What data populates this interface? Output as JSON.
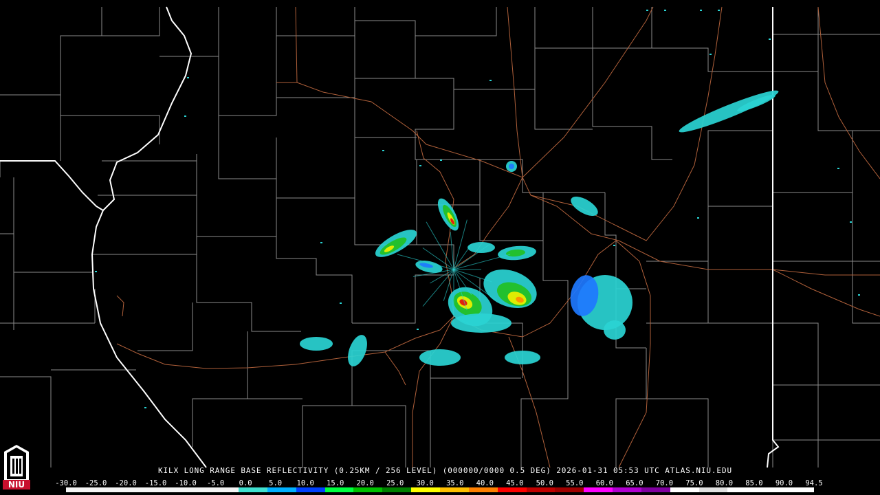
{
  "caption": "KILX LONG RANGE BASE REFLECTIVITY (0.25KM / 256 LEVEL) (000000/0000 0.5 DEG) 2026-01-31 05:53 UTC  ATLAS.NIU.EDU",
  "logo_text": "NIU",
  "scale": {
    "labels": [
      "-30.0",
      "-25.0",
      "-20.0",
      "-15.0",
      "-10.0",
      "-5.0",
      "0.0",
      "5.0",
      "10.0",
      "15.0",
      "20.0",
      "25.0",
      "30.0",
      "35.0",
      "40.0",
      "45.0",
      "50.0",
      "55.0",
      "60.0",
      "65.0",
      "70.0",
      "75.0",
      "80.0",
      "85.0",
      "90.0",
      "94.5"
    ],
    "colors": [
      "#000000",
      "#000000",
      "#000000",
      "#000000",
      "#000000",
      "#000000",
      "#40e0d0",
      "#00b0ff",
      "#0040ff",
      "#00ff40",
      "#00c000",
      "#008000",
      "#ffff00",
      "#ffc000",
      "#ff8000",
      "#ff0000",
      "#c00000",
      "#a00000",
      "#ff00ff",
      "#b000d0",
      "#8000a0",
      "#ffffff",
      "#e0e0e0",
      "#ffffff",
      "#ffffff",
      "#ffffff"
    ]
  },
  "colors": {
    "county_lines": "#8c8c8c",
    "state_lines": "#ffffff",
    "roads": "#b0603a",
    "echo_light": "#2ad4d4",
    "echo_blue": "#1e78ff",
    "echo_green": "#22c022",
    "echo_yellow": "#f0f000",
    "echo_orange": "#ff8c00",
    "echo_red": "#e01010"
  }
}
